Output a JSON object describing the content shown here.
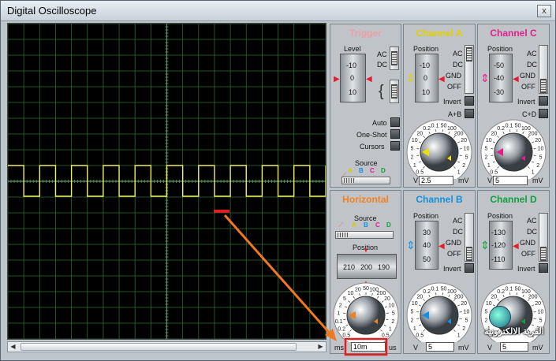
{
  "window": {
    "title": "Digital Oscilloscope",
    "close_label": "x"
  },
  "trigger": {
    "title": "Trigger",
    "level_label": "Level",
    "scale": [
      "-10",
      "0",
      "10"
    ],
    "ac": "AC",
    "dc": "DC",
    "auto": "Auto",
    "one_shot": "One-Shot",
    "cursors": "Cursors",
    "source_label": "Source",
    "sources": [
      "A",
      "B",
      "C",
      "D"
    ]
  },
  "channel_a": {
    "title": "Channel A",
    "position_label": "Position",
    "scale": [
      "-10",
      "0",
      "10"
    ],
    "modes": [
      "AC",
      "DC",
      "GND",
      "OFF"
    ],
    "invert": "Invert",
    "combine": "A+B",
    "dial": [
      "0.5",
      "1",
      "2",
      "5",
      "10",
      "20",
      "0.2",
      "0.1",
      "50",
      "100",
      "200",
      "20",
      "10",
      "5",
      "2",
      "1"
    ],
    "unit_left": "V",
    "value": "2.5",
    "unit_right": "mV",
    "color": "#f0e000"
  },
  "channel_c": {
    "title": "Channel C",
    "position_label": "Position",
    "scale": [
      "-50",
      "-40",
      "-30"
    ],
    "modes": [
      "AC",
      "DC",
      "GND",
      "OFF"
    ],
    "invert": "Invert",
    "combine": "C+D",
    "dial": [
      "0.5",
      "1",
      "2",
      "5",
      "10",
      "20",
      "0.2",
      "0.1",
      "50",
      "100",
      "200",
      "20",
      "10",
      "5",
      "2",
      "1"
    ],
    "unit_left": "V",
    "value": "5",
    "unit_right": "mV",
    "color": "#e0208c"
  },
  "horizontal": {
    "title": "Horizontal",
    "source_label": "Source",
    "sources": [
      "A",
      "B",
      "C",
      "D"
    ],
    "position_label": "Position",
    "drum": [
      "210",
      "200",
      "190"
    ],
    "dial": [
      "0.5",
      "0.2",
      "0.1",
      "1",
      "2",
      "5",
      "10",
      "20",
      "50",
      "100",
      "200",
      "20",
      "10",
      "5",
      "2",
      "1",
      "0.5"
    ],
    "unit_left": "ms",
    "value": "10m",
    "unit_right": "us",
    "color": "#f08020"
  },
  "channel_b": {
    "title": "Channel B",
    "position_label": "Position",
    "scale": [
      "30",
      "40",
      "50"
    ],
    "modes": [
      "AC",
      "DC",
      "GND",
      "OFF"
    ],
    "invert": "Invert",
    "dial": [
      "0.5",
      "1",
      "2",
      "5",
      "10",
      "20",
      "0.2",
      "0.1",
      "50",
      "100",
      "200",
      "20",
      "10",
      "5",
      "2",
      "1"
    ],
    "unit_left": "V",
    "value": "5",
    "unit_right": "mV",
    "color": "#1090e0"
  },
  "channel_d": {
    "title": "Channel D",
    "position_label": "Position",
    "scale": [
      "-130",
      "-120",
      "-110"
    ],
    "modes": [
      "AC",
      "DC",
      "GND",
      "OFF"
    ],
    "invert": "Invert",
    "dial": [
      "0.5",
      "1",
      "2",
      "5",
      "10",
      "20",
      "0.2",
      "0.1",
      "50",
      "100",
      "200",
      "20",
      "10",
      "5",
      "2",
      "1"
    ],
    "unit_left": "V",
    "value": "5",
    "unit_right": "mV",
    "color": "#10a040"
  },
  "watermark": {
    "text": "القرية الالكترونية"
  },
  "colors": {
    "trace": "#f0f060",
    "grid": "#2e6a2e",
    "annotation": "#f07820",
    "highlight": "#e02020"
  }
}
